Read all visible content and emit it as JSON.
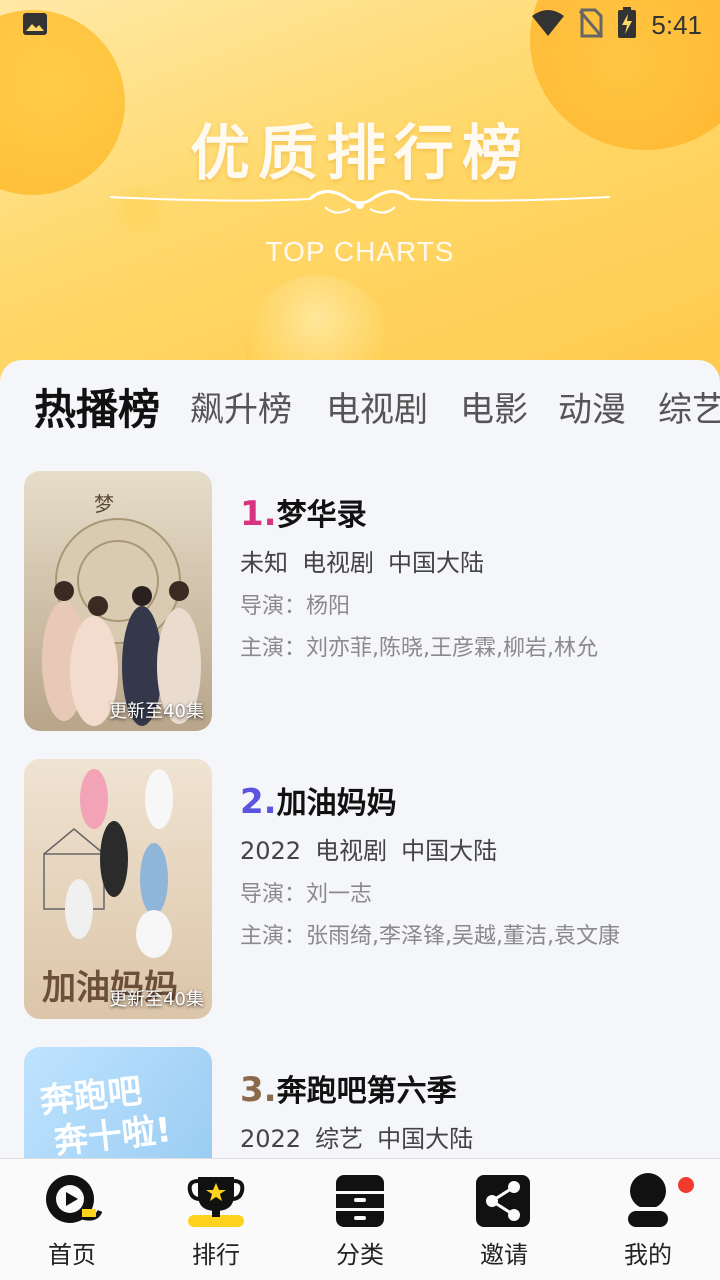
{
  "status_bar": {
    "time": "5:41",
    "icons": [
      "image-icon",
      "wifi-icon",
      "no-sim-icon",
      "battery-charging-icon"
    ]
  },
  "banner": {
    "title": "优质排行榜",
    "subtitle": "TOP CHARTS"
  },
  "tabs": [
    {
      "label": "热播榜",
      "active": true
    },
    {
      "label": "飙升榜",
      "active": false
    },
    {
      "label": "电视剧",
      "active": false
    },
    {
      "label": "电影",
      "active": false
    },
    {
      "label": "动漫",
      "active": false
    },
    {
      "label": "综艺",
      "active": false
    }
  ],
  "items": [
    {
      "rank": "1.",
      "rank_color": "#d8337f",
      "title": "梦华录",
      "year": "未知",
      "genre": "电视剧",
      "region": "中国大陆",
      "director": "导演：杨阳",
      "cast": "主演：刘亦菲,陈晓,王彦霖,柳岩,林允",
      "badge": "更新至40集",
      "poster_color": "#d9c9b4"
    },
    {
      "rank": "2.",
      "rank_color": "#5a55e0",
      "title": "加油妈妈",
      "year": "2022",
      "genre": "电视剧",
      "region": "中国大陆",
      "director": "导演：刘一志",
      "cast": "主演：张雨绮,李泽锋,吴越,董洁,袁文康",
      "badge": "更新至40集",
      "poster_color": "#e8d6c2"
    },
    {
      "rank": "3.",
      "rank_color": "#8a6a4a",
      "title": "奔跑吧第六季",
      "year": "2022",
      "genre": "综艺",
      "region": "中国大陆",
      "director": "",
      "cast": "",
      "badge": "",
      "poster_color": "#a9d3f2"
    }
  ],
  "bottom_nav": [
    {
      "label": "首页",
      "icon": "home-play-icon",
      "active": false
    },
    {
      "label": "排行",
      "icon": "trophy-icon",
      "active": true
    },
    {
      "label": "分类",
      "icon": "drawer-icon",
      "active": false
    },
    {
      "label": "邀请",
      "icon": "share-icon",
      "active": false
    },
    {
      "label": "我的",
      "icon": "user-icon",
      "active": false,
      "has_dot": true
    }
  ],
  "colors": {
    "accent_yellow": "#ffd21f",
    "notification_red": "#f23b2e"
  }
}
